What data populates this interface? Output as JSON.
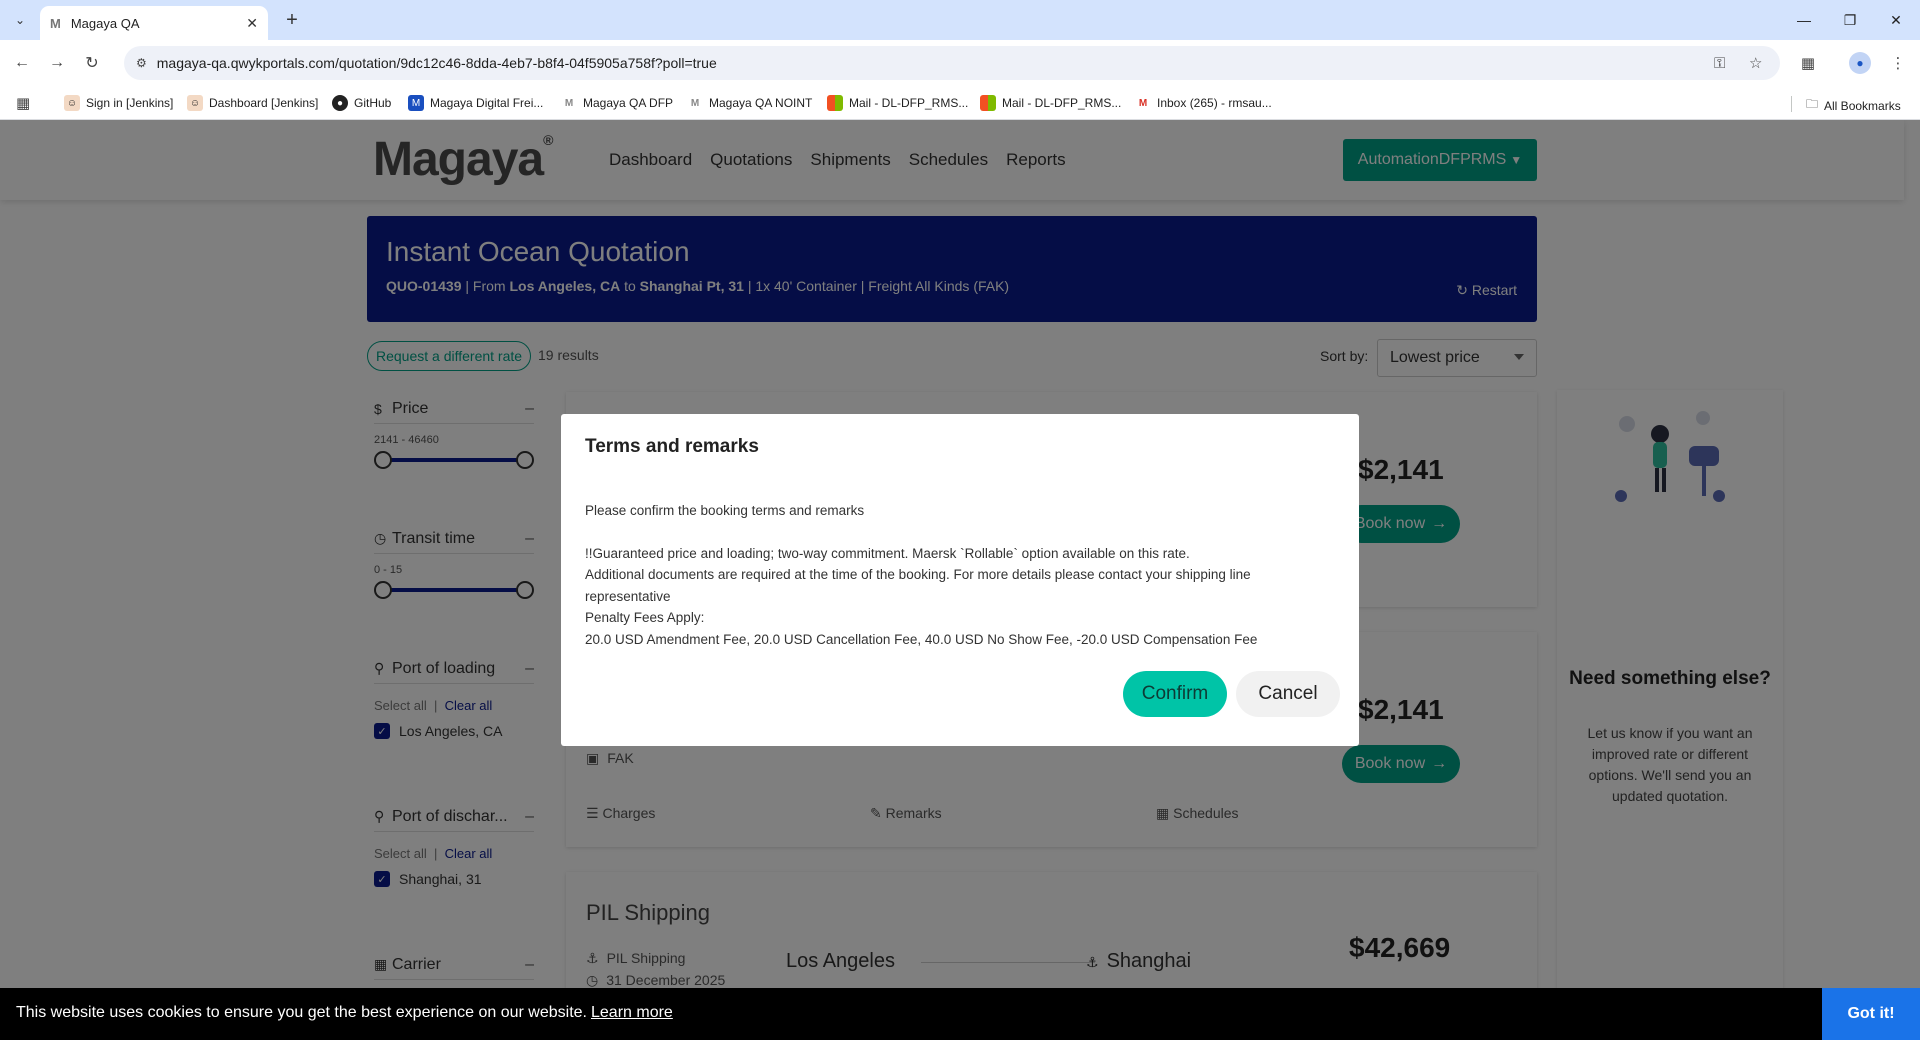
{
  "browser": {
    "tab_title": "Magaya QA",
    "tab_favicon": "M",
    "url": "magaya-qa.qwykportals.com/quotation/9dc12c46-8dda-4eb7-b8f4-04f5905a758f?poll=true",
    "bookmarks": [
      {
        "label": "Sign in [Jenkins]",
        "icon": "jenkins-icon"
      },
      {
        "label": "Dashboard [Jenkins]",
        "icon": "jenkins-icon"
      },
      {
        "label": "GitHub",
        "icon": "github-icon"
      },
      {
        "label": "Magaya Digital Frei...",
        "icon": "magaya-icon"
      },
      {
        "label": "Magaya QA DFP",
        "icon": "magaya-icon"
      },
      {
        "label": "Magaya QA NOINT",
        "icon": "magaya-icon"
      },
      {
        "label": "Mail - DL-DFP_RMS...",
        "icon": "microsoft-icon"
      },
      {
        "label": "Mail - DL-DFP_RMS...",
        "icon": "microsoft-icon"
      },
      {
        "label": "Inbox (265) - rmsau...",
        "icon": "gmail-icon"
      }
    ],
    "all_bookmarks": "All Bookmarks"
  },
  "header": {
    "logo": "Magaya",
    "nav": [
      "Dashboard",
      "Quotations",
      "Shipments",
      "Schedules",
      "Reports"
    ],
    "user": "AutomationDFPRMS"
  },
  "banner": {
    "title": "Instant Ocean Quotation",
    "quote_id": "QUO-01439",
    "from_label": "| From",
    "origin": "Los Angeles, CA",
    "to_label": "to",
    "destination": "Shanghai Pt, 31",
    "details": "|  1x 40' Container | Freight All Kinds (FAK)",
    "restart": "Restart"
  },
  "toolbar": {
    "request_rate": "Request a different rate",
    "results": "19 results",
    "sort_label": "Sort by:",
    "sort_value": "Lowest price"
  },
  "filters": {
    "price": {
      "label": "Price",
      "range": "2141 - 46460"
    },
    "transit": {
      "label": "Transit time",
      "range": "0 - 15"
    },
    "loading": {
      "label": "Port of loading",
      "select_all": "Select all",
      "clear_all": "Clear all",
      "option": "Los Angeles, CA"
    },
    "discharge": {
      "label": "Port of dischar...",
      "select_all": "Select all",
      "clear_all": "Clear all",
      "option": "Shanghai, 31"
    },
    "carrier": {
      "label": "Carrier"
    }
  },
  "cards": [
    {
      "price": "$2,141",
      "book": "Book now"
    },
    {
      "price": "$2,141",
      "book": "Book now",
      "commodity": "FAK",
      "charges": "Charges",
      "remarks": "Remarks",
      "schedules": "Schedules"
    },
    {
      "carrier": "PIL Shipping",
      "carrier_sub": "PIL Shipping",
      "date": "31 December 2025",
      "origin": "Los Angeles",
      "destination": "Shanghai",
      "price": "$42,669"
    }
  ],
  "side_panel": {
    "title": "Need something else?",
    "text": "Let us know if you want an improved rate or different options. We'll send you an updated quotation."
  },
  "modal": {
    "title": "Terms and remarks",
    "intro": "Please confirm the booking terms and remarks",
    "line1": "!!Guaranteed price and loading; two-way commitment. Maersk `Rollable` option available on this rate.",
    "line2": "Additional documents are required at the time of the booking. For more details please contact your shipping line representative",
    "line3": "Penalty Fees Apply:",
    "line4": "20.0 USD Amendment Fee, 20.0 USD Cancellation Fee, 40.0 USD No Show Fee, -20.0 USD Compensation Fee",
    "confirm": "Confirm",
    "cancel": "Cancel"
  },
  "cookie": {
    "text": "This website uses cookies to ensure you get the best experience on our website.",
    "learn_more": "Learn more",
    "button": "Got it!"
  }
}
